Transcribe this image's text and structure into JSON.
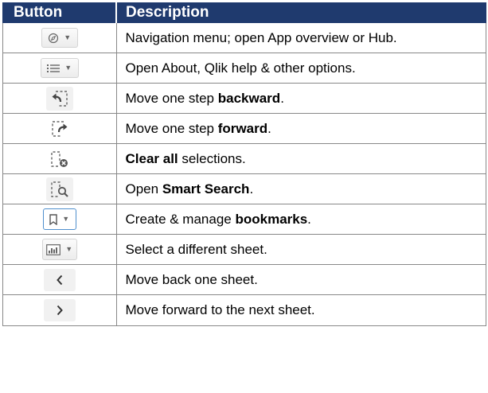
{
  "header": {
    "button": "Button",
    "description": "Description"
  },
  "rows": [
    {
      "icon": "compass-icon",
      "parts": [
        "Navigation menu; open App overview or Hub.",
        "",
        ""
      ]
    },
    {
      "icon": "list-menu-icon",
      "parts": [
        "Open About, Qlik help & other options.",
        "",
        ""
      ]
    },
    {
      "icon": "step-back-icon",
      "parts": [
        "Move one step ",
        "backward",
        "."
      ]
    },
    {
      "icon": "step-forward-icon",
      "parts": [
        "Move one step ",
        "forward",
        "."
      ]
    },
    {
      "icon": "clear-selections-icon",
      "parts": [
        "",
        "Clear all",
        " selections."
      ]
    },
    {
      "icon": "smart-search-icon",
      "parts": [
        "Open ",
        "Smart Search",
        "."
      ]
    },
    {
      "icon": "bookmark-icon",
      "parts": [
        "Create & manage ",
        "bookmarks",
        "."
      ]
    },
    {
      "icon": "sheet-icon",
      "parts": [
        "Select a different sheet.",
        "",
        ""
      ]
    },
    {
      "icon": "chevron-left-icon",
      "parts": [
        "Move back one sheet.",
        "",
        ""
      ]
    },
    {
      "icon": "chevron-right-icon",
      "parts": [
        "Move forward to the next sheet.",
        "",
        ""
      ]
    }
  ],
  "colors": {
    "header_bg": "#1f3a6e",
    "bookmark_border": "#4f8fcd",
    "icon": "#555555"
  }
}
